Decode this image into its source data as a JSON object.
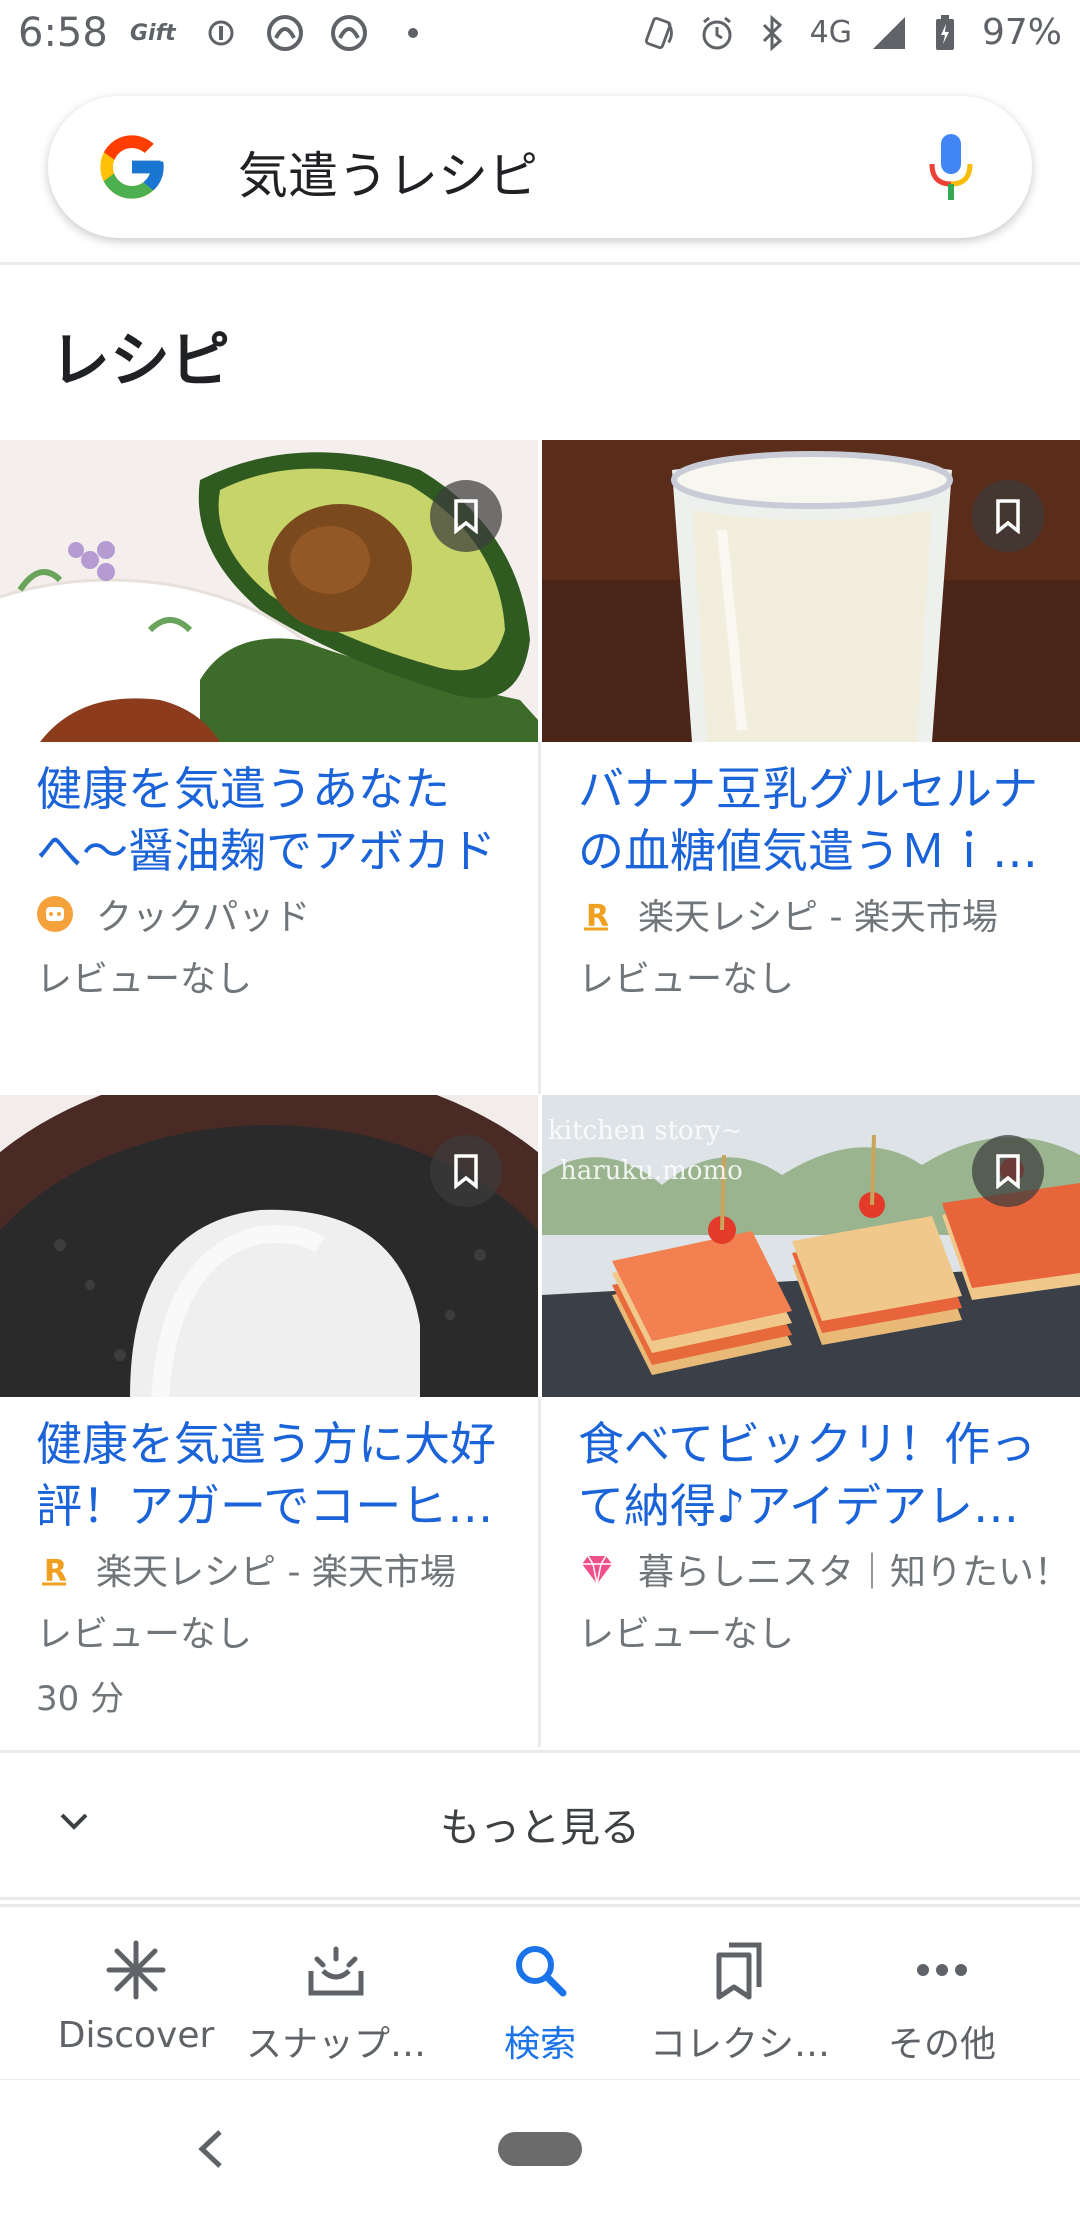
{
  "status_bar": {
    "time": "6:58",
    "gift_label": "Gift",
    "network": "4G",
    "battery": "97%"
  },
  "search": {
    "query": "気遣うレシピ",
    "logo_icon": "google-g-icon",
    "mic_icon": "mic-icon"
  },
  "section": {
    "title": "レシピ"
  },
  "cards": [
    {
      "title": "健康を気遣うあなたへ〜醤油麹でアボカド♬",
      "source": "クックパッド",
      "source_icon": "cookpad-icon",
      "review": "レビューなし",
      "time": ""
    },
    {
      "title": "バナナ豆乳グルセルナの血糖値気遣うＭｉ…",
      "source": "楽天レシピ - 楽天市場",
      "source_icon": "rakuten-icon",
      "review": "レビューなし",
      "time": ""
    },
    {
      "title": "健康を気遣う方に大好評！アガーでコーヒ…",
      "source": "楽天レシピ - 楽天市場",
      "source_icon": "rakuten-icon",
      "review": "レビューなし",
      "time": "30 分"
    },
    {
      "title": "食べてビックリ！作って納得♪アイデアレ…",
      "source": "暮らしニスタ｜知りたい！",
      "source_icon": "kurashinista-icon",
      "review": "レビューなし",
      "time": "",
      "thumb_overlay_line1": "kitchen story~",
      "thumb_overlay_line2": "haruku.momo"
    }
  ],
  "more": {
    "label": "もっと見る"
  },
  "bottom_nav": {
    "items": [
      {
        "label": "Discover",
        "icon": "asterisk-icon"
      },
      {
        "label": "スナップ…",
        "icon": "snapshot-icon"
      },
      {
        "label": "検索",
        "icon": "search-icon",
        "active": true
      },
      {
        "label": "コレクシ…",
        "icon": "collections-icon"
      },
      {
        "label": "その他",
        "icon": "more-dots-icon"
      }
    ]
  },
  "colors": {
    "link_blue": "#1a63d8",
    "active_blue": "#1a73e8",
    "secondary_text": "#70757a"
  }
}
